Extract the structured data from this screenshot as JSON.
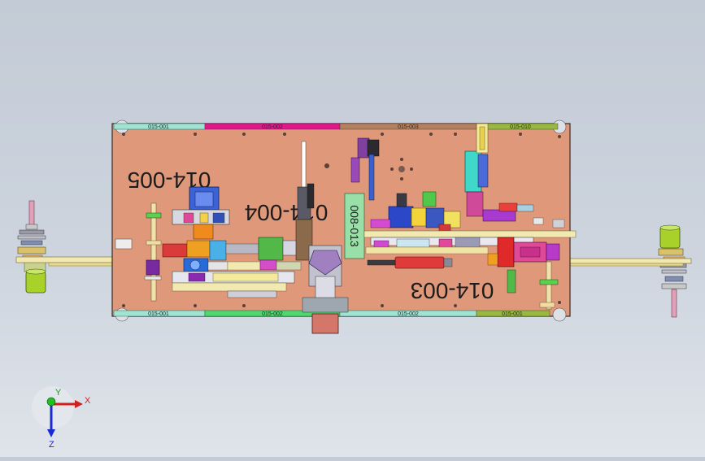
{
  "drawing": {
    "plate_labels": {
      "top_left": "014-005",
      "top_mid": "014-004",
      "bottom_right": "014-003",
      "vertical": "008-013"
    },
    "top_strip_labels": [
      "015-001",
      "015-002",
      "015-003",
      "015-010"
    ],
    "bottom_strip_labels": [
      "015-001",
      "015-002",
      "015-002",
      "015-001"
    ],
    "colors": {
      "plate": "#e0987a",
      "strip_cyan": "#9fe3d2",
      "strip_magenta": "#e0188a",
      "strip_brown": "#b6805e",
      "strip_olive": "#98b840",
      "strip_green": "#4ed86e",
      "rail": "#f2e9b0"
    }
  },
  "triad": {
    "x_label": "X",
    "y_label": "Y",
    "z_label": "Z"
  }
}
